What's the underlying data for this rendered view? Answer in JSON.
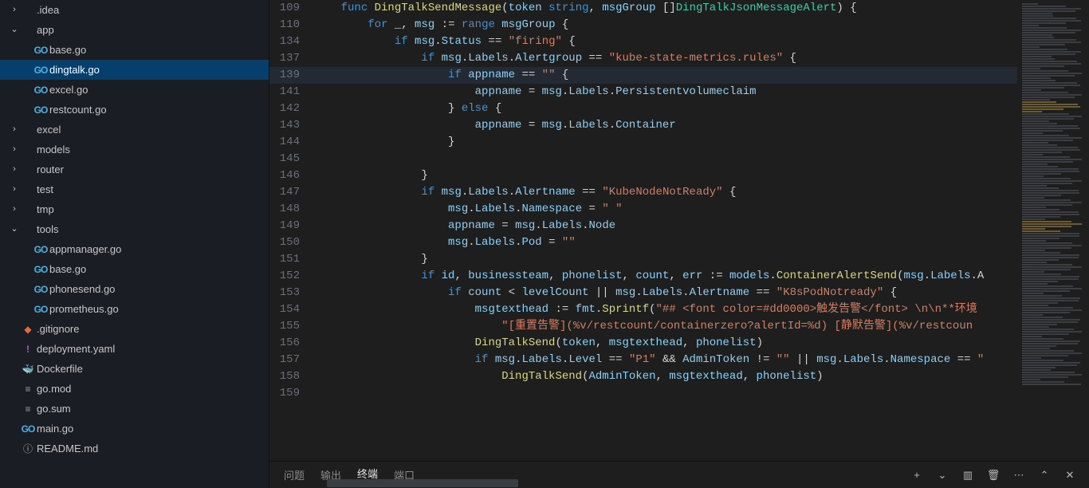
{
  "explorer": {
    "items": [
      {
        "depth": 0,
        "type": "folder",
        "name": ".idea",
        "open": false,
        "icon": "folder"
      },
      {
        "depth": 0,
        "type": "folder",
        "name": "app",
        "open": true,
        "icon": "folder"
      },
      {
        "depth": 1,
        "type": "file",
        "name": "base.go",
        "icon": "go"
      },
      {
        "depth": 1,
        "type": "file",
        "name": "dingtalk.go",
        "icon": "go",
        "selected": true
      },
      {
        "depth": 1,
        "type": "file",
        "name": "excel.go",
        "icon": "go"
      },
      {
        "depth": 1,
        "type": "file",
        "name": "restcount.go",
        "icon": "go"
      },
      {
        "depth": 0,
        "type": "folder",
        "name": "excel",
        "open": false,
        "icon": "folder"
      },
      {
        "depth": 0,
        "type": "folder",
        "name": "models",
        "open": false,
        "icon": "folder"
      },
      {
        "depth": 0,
        "type": "folder",
        "name": "router",
        "open": false,
        "icon": "folder"
      },
      {
        "depth": 0,
        "type": "folder",
        "name": "test",
        "open": false,
        "icon": "folder"
      },
      {
        "depth": 0,
        "type": "folder",
        "name": "tmp",
        "open": false,
        "icon": "folder"
      },
      {
        "depth": 0,
        "type": "folder",
        "name": "tools",
        "open": true,
        "icon": "folder"
      },
      {
        "depth": 1,
        "type": "file",
        "name": "appmanager.go",
        "icon": "go"
      },
      {
        "depth": 1,
        "type": "file",
        "name": "base.go",
        "icon": "go"
      },
      {
        "depth": 1,
        "type": "file",
        "name": "phonesend.go",
        "icon": "go"
      },
      {
        "depth": 1,
        "type": "file",
        "name": "prometheus.go",
        "icon": "go"
      },
      {
        "depth": 0,
        "type": "file",
        "name": ".gitignore",
        "icon": "git"
      },
      {
        "depth": 0,
        "type": "file",
        "name": "deployment.yaml",
        "icon": "yaml"
      },
      {
        "depth": 0,
        "type": "file",
        "name": "Dockerfile",
        "icon": "docker"
      },
      {
        "depth": 0,
        "type": "file",
        "name": "go.mod",
        "icon": "mod"
      },
      {
        "depth": 0,
        "type": "file",
        "name": "go.sum",
        "icon": "mod"
      },
      {
        "depth": 0,
        "type": "file",
        "name": "main.go",
        "icon": "go"
      },
      {
        "depth": 0,
        "type": "file",
        "name": "README.md",
        "icon": "readme"
      }
    ]
  },
  "editor": {
    "lines": [
      {
        "n": 109,
        "tokens": [
          [
            "",
            "    "
          ],
          [
            "kw",
            "func"
          ],
          [
            "",
            " "
          ],
          [
            "fn",
            "DingTalkSendMessage"
          ],
          [
            "pun",
            "("
          ],
          [
            "id",
            "token"
          ],
          [
            "",
            " "
          ],
          [
            "kw",
            "string"
          ],
          [
            "pun",
            ", "
          ],
          [
            "id",
            "msgGroup"
          ],
          [
            "",
            " []"
          ],
          [
            "ty",
            "DingTalkJsonMessageAlert"
          ],
          [
            "pun",
            ") {"
          ]
        ]
      },
      {
        "n": 110,
        "tokens": [
          [
            "",
            "        "
          ],
          [
            "kw",
            "for"
          ],
          [
            "",
            " _, "
          ],
          [
            "id",
            "msg"
          ],
          [
            "",
            " := "
          ],
          [
            "kw",
            "range"
          ],
          [
            "",
            " "
          ],
          [
            "id",
            "msgGroup"
          ],
          [
            "pun",
            " {"
          ]
        ]
      },
      {
        "n": 134,
        "tokens": [
          [
            "",
            "            "
          ],
          [
            "kw",
            "if"
          ],
          [
            "",
            " "
          ],
          [
            "id",
            "msg"
          ],
          [
            "pun",
            "."
          ],
          [
            "id",
            "Status"
          ],
          [
            "",
            " == "
          ],
          [
            "str",
            "\"firing\""
          ],
          [
            "pun",
            " {"
          ]
        ]
      },
      {
        "n": 137,
        "tokens": [
          [
            "",
            "                "
          ],
          [
            "kw",
            "if"
          ],
          [
            "",
            " "
          ],
          [
            "id",
            "msg"
          ],
          [
            "pun",
            "."
          ],
          [
            "id",
            "Labels"
          ],
          [
            "pun",
            "."
          ],
          [
            "id",
            "Alertgroup"
          ],
          [
            "",
            " == "
          ],
          [
            "str",
            "\"kube-state-metrics.rules\""
          ],
          [
            "pun",
            " {"
          ]
        ]
      },
      {
        "n": 139,
        "hl": true,
        "tokens": [
          [
            "",
            "                    "
          ],
          [
            "kw",
            "if"
          ],
          [
            "",
            " "
          ],
          [
            "id",
            "appname"
          ],
          [
            "",
            " == "
          ],
          [
            "str",
            "\"\""
          ],
          [
            "pun",
            " {"
          ]
        ]
      },
      {
        "n": 141,
        "tokens": [
          [
            "",
            "                        "
          ],
          [
            "id",
            "appname"
          ],
          [
            "",
            " = "
          ],
          [
            "id",
            "msg"
          ],
          [
            "pun",
            "."
          ],
          [
            "id",
            "Labels"
          ],
          [
            "pun",
            "."
          ],
          [
            "id",
            "Persistentvolumeclaim"
          ]
        ]
      },
      {
        "n": 142,
        "tokens": [
          [
            "",
            "                    } "
          ],
          [
            "kw",
            "else"
          ],
          [
            "pun",
            " {"
          ]
        ]
      },
      {
        "n": 143,
        "tokens": [
          [
            "",
            "                        "
          ],
          [
            "id",
            "appname"
          ],
          [
            "",
            " = "
          ],
          [
            "id",
            "msg"
          ],
          [
            "pun",
            "."
          ],
          [
            "id",
            "Labels"
          ],
          [
            "pun",
            "."
          ],
          [
            "id",
            "Container"
          ]
        ]
      },
      {
        "n": 144,
        "tokens": [
          [
            "",
            "                    }"
          ]
        ]
      },
      {
        "n": 145,
        "tokens": [
          [
            "",
            ""
          ]
        ]
      },
      {
        "n": 146,
        "tokens": [
          [
            "",
            "                }"
          ]
        ]
      },
      {
        "n": 147,
        "tokens": [
          [
            "",
            "                "
          ],
          [
            "kw",
            "if"
          ],
          [
            "",
            " "
          ],
          [
            "id",
            "msg"
          ],
          [
            "pun",
            "."
          ],
          [
            "id",
            "Labels"
          ],
          [
            "pun",
            "."
          ],
          [
            "id",
            "Alertname"
          ],
          [
            "",
            " == "
          ],
          [
            "str",
            "\"KubeNodeNotReady\""
          ],
          [
            "pun",
            " {"
          ]
        ]
      },
      {
        "n": 148,
        "tokens": [
          [
            "",
            "                    "
          ],
          [
            "id",
            "msg"
          ],
          [
            "pun",
            "."
          ],
          [
            "id",
            "Labels"
          ],
          [
            "pun",
            "."
          ],
          [
            "id",
            "Namespace"
          ],
          [
            "",
            " = "
          ],
          [
            "str",
            "\" \""
          ]
        ]
      },
      {
        "n": 149,
        "tokens": [
          [
            "",
            "                    "
          ],
          [
            "id",
            "appname"
          ],
          [
            "",
            " = "
          ],
          [
            "id",
            "msg"
          ],
          [
            "pun",
            "."
          ],
          [
            "id",
            "Labels"
          ],
          [
            "pun",
            "."
          ],
          [
            "id",
            "Node"
          ]
        ]
      },
      {
        "n": 150,
        "tokens": [
          [
            "",
            "                    "
          ],
          [
            "id",
            "msg"
          ],
          [
            "pun",
            "."
          ],
          [
            "id",
            "Labels"
          ],
          [
            "pun",
            "."
          ],
          [
            "id",
            "Pod"
          ],
          [
            "",
            " = "
          ],
          [
            "str",
            "\"\""
          ]
        ]
      },
      {
        "n": 151,
        "tokens": [
          [
            "",
            "                }"
          ]
        ]
      },
      {
        "n": 152,
        "tokens": [
          [
            "",
            "                "
          ],
          [
            "kw",
            "if"
          ],
          [
            "",
            " "
          ],
          [
            "id",
            "id"
          ],
          [
            "pun",
            ", "
          ],
          [
            "id",
            "businessteam"
          ],
          [
            "pun",
            ", "
          ],
          [
            "id",
            "phonelist"
          ],
          [
            "pun",
            ", "
          ],
          [
            "id",
            "count"
          ],
          [
            "pun",
            ", "
          ],
          [
            "id",
            "err"
          ],
          [
            "",
            " := "
          ],
          [
            "id",
            "models"
          ],
          [
            "pun",
            "."
          ],
          [
            "fn",
            "ContainerAlertSend"
          ],
          [
            "pun",
            "("
          ],
          [
            "id",
            "msg"
          ],
          [
            "pun",
            "."
          ],
          [
            "id",
            "Labels"
          ],
          [
            "pun",
            ".A"
          ]
        ]
      },
      {
        "n": 153,
        "tokens": [
          [
            "",
            "                    "
          ],
          [
            "kw",
            "if"
          ],
          [
            "",
            " "
          ],
          [
            "id",
            "count"
          ],
          [
            "",
            " < "
          ],
          [
            "id",
            "levelCount"
          ],
          [
            "",
            " || "
          ],
          [
            "id",
            "msg"
          ],
          [
            "pun",
            "."
          ],
          [
            "id",
            "Labels"
          ],
          [
            "pun",
            "."
          ],
          [
            "id",
            "Alertname"
          ],
          [
            "",
            " == "
          ],
          [
            "str",
            "\"K8sPodNotready\""
          ],
          [
            "pun",
            " {"
          ]
        ]
      },
      {
        "n": 154,
        "tokens": [
          [
            "",
            "                        "
          ],
          [
            "id",
            "msgtexthead"
          ],
          [
            "",
            " := "
          ],
          [
            "id",
            "fmt"
          ],
          [
            "pun",
            "."
          ],
          [
            "fn",
            "Sprintf"
          ],
          [
            "pun",
            "("
          ],
          [
            "str",
            "\"## <font color=#dd0000>触发告警</font> \\n\\n**环境"
          ]
        ]
      },
      {
        "n": 155,
        "tokens": [
          [
            "",
            "                            "
          ],
          [
            "str",
            "\"[重置告警](%v/restcount/containerzero?alertId=%d) [静默告警](%v/restcoun"
          ]
        ]
      },
      {
        "n": 156,
        "tokens": [
          [
            "",
            "                        "
          ],
          [
            "fn",
            "DingTalkSend"
          ],
          [
            "pun",
            "("
          ],
          [
            "id",
            "token"
          ],
          [
            "pun",
            ", "
          ],
          [
            "id",
            "msgtexthead"
          ],
          [
            "pun",
            ", "
          ],
          [
            "id",
            "phonelist"
          ],
          [
            "pun",
            ")"
          ]
        ]
      },
      {
        "n": 157,
        "tokens": [
          [
            "",
            "                        "
          ],
          [
            "kw",
            "if"
          ],
          [
            "",
            " "
          ],
          [
            "id",
            "msg"
          ],
          [
            "pun",
            "."
          ],
          [
            "id",
            "Labels"
          ],
          [
            "pun",
            "."
          ],
          [
            "id",
            "Level"
          ],
          [
            "",
            " == "
          ],
          [
            "str",
            "\"P1\""
          ],
          [
            "",
            " && "
          ],
          [
            "id",
            "AdminToken"
          ],
          [
            "",
            " != "
          ],
          [
            "str",
            "\"\""
          ],
          [
            "",
            " || "
          ],
          [
            "id",
            "msg"
          ],
          [
            "pun",
            "."
          ],
          [
            "id",
            "Labels"
          ],
          [
            "pun",
            "."
          ],
          [
            "id",
            "Namespace"
          ],
          [
            "",
            " == "
          ],
          [
            "str",
            "\""
          ]
        ]
      },
      {
        "n": 158,
        "tokens": [
          [
            "",
            "                            "
          ],
          [
            "fn",
            "DingTalkSend"
          ],
          [
            "pun",
            "("
          ],
          [
            "id",
            "AdminToken"
          ],
          [
            "pun",
            ", "
          ],
          [
            "id",
            "msgtexthead"
          ],
          [
            "pun",
            ", "
          ],
          [
            "id",
            "phonelist"
          ],
          [
            "pun",
            ")"
          ]
        ]
      },
      {
        "n": 159,
        "tokens": [
          [
            "",
            ""
          ]
        ]
      }
    ]
  },
  "panel": {
    "tabs": [
      {
        "label": "问题",
        "active": false
      },
      {
        "label": "输出",
        "active": false
      },
      {
        "label": "终端",
        "active": true
      },
      {
        "label": "端口",
        "active": false
      }
    ]
  },
  "icons": {
    "chevron_right": "›",
    "chevron_down": "⌄",
    "go": "GO",
    "git": "◆",
    "yaml": "!",
    "docker": "🐳",
    "mod": "≡",
    "link": "🔗",
    "readme": "ⓘ",
    "plus": "+",
    "split": "▥",
    "trash": "🗑",
    "more": "⋯",
    "up": "⌃",
    "close": "✕",
    "dropdown": "⌄"
  }
}
